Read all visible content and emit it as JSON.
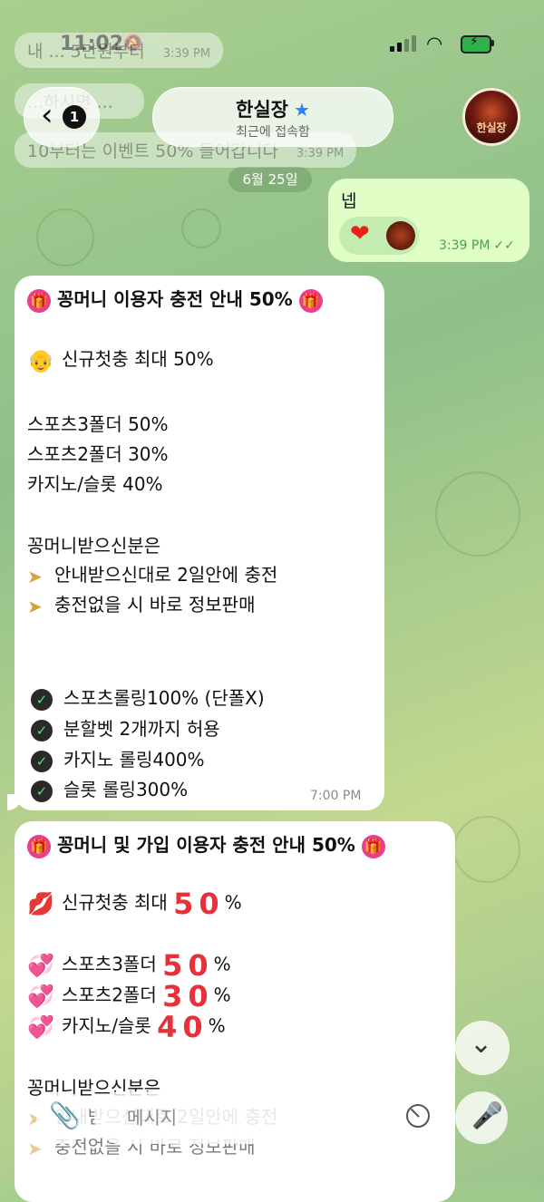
{
  "status_bar": {
    "time": "11:02"
  },
  "header": {
    "back_count": "1",
    "title": "한실장",
    "subtitle": "최근에 접속함",
    "avatar_text": "한실장"
  },
  "ghost_messages": [
    {
      "text": "내 ... 5만원부터",
      "time": "3:39 PM"
    },
    {
      "text": "...하시면 ...",
      "time": ""
    },
    {
      "text": "10부터는 이벤트 50% 들어갑니다",
      "time": "3:39 PM"
    }
  ],
  "date_separator": "6월 25일",
  "outgoing": {
    "text": "넵",
    "reaction_emoji": "❤",
    "time": "3:39 PM"
  },
  "message1": {
    "title": "꽁머니 이용자 충전 안내 50%",
    "line1": "신규첫충 최대 50%",
    "line2": "스포츠3폴더 50%",
    "line3": "스포츠2폴더 30%",
    "line4": "카지노/슬롯 40%",
    "line5": "꽁머니받으신분은",
    "line6": "안내받으신대로 2일안에 충전",
    "line7": "충전없을 시 바로 정보판매",
    "check1": "스포츠롤링100% (단폴X)",
    "check2": "분할벳 2개까지 허용",
    "check3": "카지노 롤링400%",
    "check4": "슬롯 롤링300%",
    "time": "7:00 PM"
  },
  "message2": {
    "title": "꽁머니 및 가입 이용자 충전 안내 50%",
    "line1_label": "신규첫충 최대",
    "line1_value": "50",
    "line2_label": "스포츠3폴더",
    "line2_value": "50",
    "line3_label": "스포츠2폴더",
    "line3_value": "30",
    "line4_label": "카지노/슬롯",
    "line4_value": "40",
    "percent": "%",
    "line5": "꽁머니받으신분은",
    "line6": "안내받으신대로 2일안에 충전",
    "line7": "충전없을 시 바로 정보판매"
  },
  "composer": {
    "placeholder": "메시지"
  },
  "icons": {
    "back": "chevron-left-icon",
    "verified": "star-icon",
    "mute": "bell-off-icon",
    "attach": "paperclip-icon",
    "sticker": "sticker-icon",
    "mic": "microphone-icon",
    "scroll": "chevron-down-icon",
    "gift": "gift-icon",
    "check": "check-icon",
    "plane": "paper-plane-icon"
  },
  "colors": {
    "outgoing_bubble": "#e1fec6",
    "accent_blue": "#2a7fff",
    "number_red": "#e8303a"
  }
}
